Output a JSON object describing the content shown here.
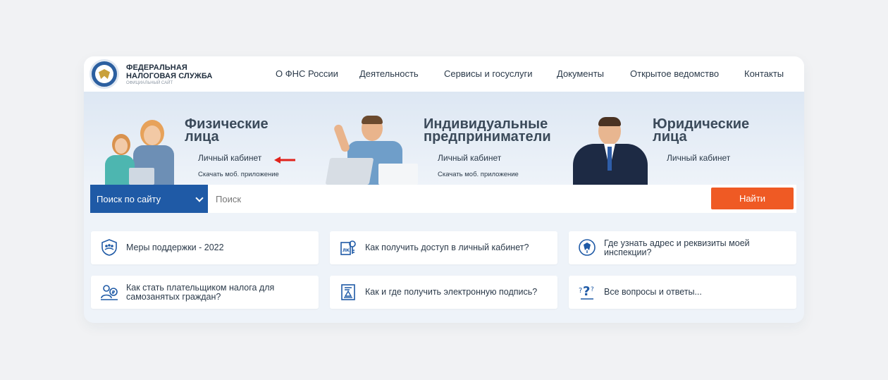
{
  "brand": {
    "line1": "ФЕДЕРАЛЬНАЯ",
    "line2": "НАЛОГОВАЯ СЛУЖБА",
    "sub": "ОФИЦИАЛЬНЫЙ САЙТ"
  },
  "nav": {
    "items": [
      {
        "label": "О ФНС России"
      },
      {
        "label": "Деятельность"
      },
      {
        "label": "Сервисы и госуслуги"
      },
      {
        "label": "Документы"
      },
      {
        "label": "Открытое ведомство"
      },
      {
        "label": "Контакты"
      }
    ]
  },
  "hero": {
    "individuals": {
      "title1": "Физические",
      "title2": "лица",
      "cabinet": "Личный кабинет",
      "app": "Скачать моб. приложение"
    },
    "entrepreneurs": {
      "title1": "Индивидуальные",
      "title2": "предприниматели",
      "cabinet": "Личный кабинет",
      "app": "Скачать моб. приложение"
    },
    "legal": {
      "title1": "Юридические",
      "title2": "лица",
      "cabinet": "Личный кабинет"
    }
  },
  "search": {
    "scope": "Поиск по сайту",
    "placeholder": "Поиск",
    "button": "Найти"
  },
  "tiles": [
    {
      "label": "Меры поддержки - 2022",
      "icon": "shield-people-icon"
    },
    {
      "label": "Как получить доступ в личный кабинет?",
      "icon": "lk-key-icon"
    },
    {
      "label": "Где узнать адрес и реквизиты моей инспекции?",
      "icon": "emblem-icon"
    },
    {
      "label": "Как стать плательщиком налога для самозанятых граждан?",
      "icon": "self-employed-icon"
    },
    {
      "label": "Как и где получить электронную подпись?",
      "icon": "e-signature-icon"
    },
    {
      "label": "Все вопросы и ответы...",
      "icon": "questions-icon"
    }
  ],
  "colors": {
    "accent": "#1f5aa6",
    "button": "#ef5a24",
    "arrow": "#e0231c"
  }
}
